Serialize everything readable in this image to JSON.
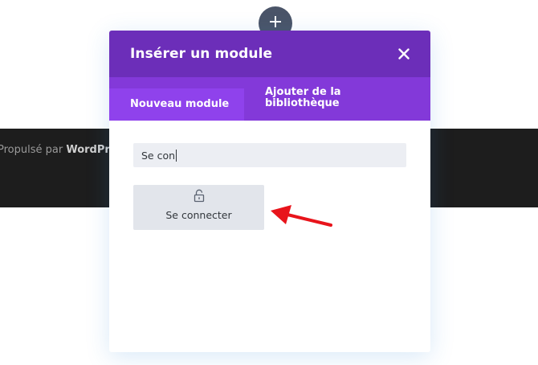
{
  "background": {
    "footer_prefix": "Propulsé par ",
    "footer_brand": "WordPr",
    "add_button_icon": "plus-icon"
  },
  "modal": {
    "title": "Insérer un module",
    "close_icon": "close-icon",
    "tabs": [
      {
        "label": "Nouveau module",
        "active": true
      },
      {
        "label": "Ajouter de la bibliothèque",
        "active": false
      }
    ],
    "search": {
      "value": "Se con",
      "placeholder": ""
    },
    "modules": [
      {
        "label": "Se connecter",
        "icon": "lock-icon"
      }
    ]
  },
  "annotation": {
    "icon": "arrow-icon",
    "color": "#e8141b"
  },
  "colors": {
    "header": "#6c2eb9",
    "tabs_bar": "#8339d9",
    "tab_active": "#8f42ec",
    "input_bg": "#eceef3",
    "card_bg": "#e2e5eb",
    "footer_bg": "#1d1d1d"
  }
}
